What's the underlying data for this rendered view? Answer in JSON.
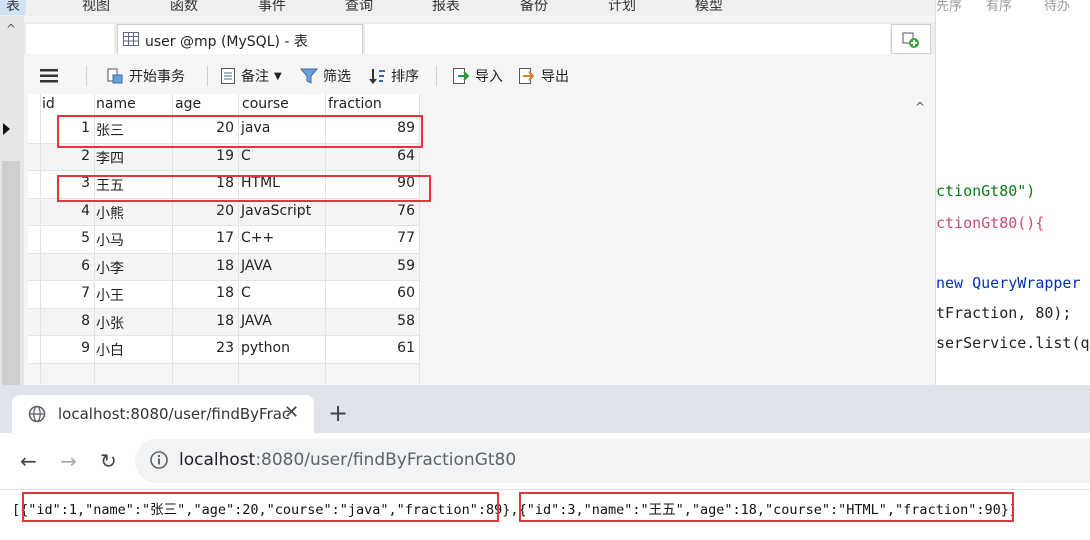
{
  "menubar": {
    "items": [
      "表",
      "视图",
      "函数",
      "事件",
      "查询",
      "报表",
      "备份",
      "计划",
      "模型"
    ]
  },
  "code": {
    "tabs": [
      "先序",
      "有序",
      "待办"
    ],
    "lines": [
      {
        "pre": "ctionGt80\")",
        "cls": "str"
      },
      {
        "pre": "ctionGt80(){",
        "cls": "plain"
      },
      {
        "pre": "new QueryWrapper",
        "cls": "kw"
      },
      {
        "pre": "tFraction, 80);",
        "cls": "num"
      },
      {
        "pre": "serService.list(q",
        "cls": "plain"
      }
    ]
  },
  "navicat": {
    "tab_title": "user @mp (MySQL) - 表",
    "toolbar": {
      "menu_icon": "hamburger-icon",
      "begin_tx": "开始事务",
      "memo": "备注",
      "filter": "筛选",
      "sort": "排序",
      "import": "导入",
      "export": "导出"
    },
    "columns": [
      "id",
      "name",
      "age",
      "course",
      "fraction"
    ],
    "rows": [
      {
        "id": "1",
        "name": "张三",
        "age": "20",
        "course": "java",
        "fraction": "89"
      },
      {
        "id": "2",
        "name": "李四",
        "age": "19",
        "course": "C",
        "fraction": "64"
      },
      {
        "id": "3",
        "name": "王五",
        "age": "18",
        "course": "HTML",
        "fraction": "90"
      },
      {
        "id": "4",
        "name": "小熊",
        "age": "20",
        "course": "JavaScript",
        "fraction": "76"
      },
      {
        "id": "5",
        "name": "小马",
        "age": "17",
        "course": "C++",
        "fraction": "77"
      },
      {
        "id": "6",
        "name": "小李",
        "age": "18",
        "course": "JAVA",
        "fraction": "59"
      },
      {
        "id": "7",
        "name": "小王",
        "age": "18",
        "course": "C",
        "fraction": "60"
      },
      {
        "id": "8",
        "name": "小张",
        "age": "18",
        "course": "JAVA",
        "fraction": "58"
      },
      {
        "id": "9",
        "name": "小白",
        "age": "23",
        "course": "python",
        "fraction": "61"
      }
    ],
    "highlight_color": "#e5343c"
  },
  "browser": {
    "tab_title": "localhost:8080/user/findByFrac",
    "close_glyph": "✕",
    "newtab_glyph": "+",
    "url_host": "localhost",
    "url_rest": ":8080/user/findByFractionGt80",
    "nav_back": "←",
    "nav_forward": "→",
    "nav_reload": "↻",
    "response_parts": [
      "[",
      "{\"id\":1,\"name\":\"张三\",\"age\":20,\"course\":\"java\",\"fraction\":89}",
      ",",
      "{\"id\":3,\"name\":\"王五\",\"age\":18,\"course\":\"HTML\",\"fraction\":90}",
      "]"
    ]
  }
}
